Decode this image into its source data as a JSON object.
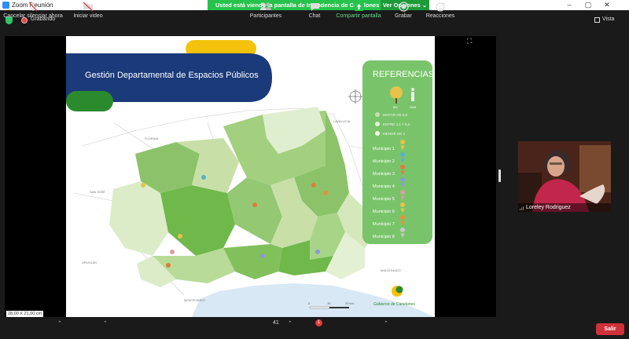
{
  "window": {
    "title": "Zoom Reunión"
  },
  "banner": {
    "message": "Usted está viendo la pantalla de Intendencia de Canelones",
    "options_label": "Ver Opciones"
  },
  "status": {
    "recording_label": "Grabando",
    "view_label": "Vista"
  },
  "slide": {
    "heading": "Gestión Departamental de Espacios Públicos",
    "legend_title": "REFERENCIAS",
    "legend_small": [
      "M2",
      "HAB"
    ],
    "legend_ranges": [
      "MAYOR DE 8.5",
      "ENTRE 4,5 Y 8,5",
      "MENOR DE 4"
    ],
    "legend_regions": [
      "Municipio 1",
      "Municipio 2",
      "Municipio 3",
      "Municipio 4",
      "Municipio 5",
      "Municipio 6",
      "Municipio 7",
      "Municipio 8"
    ],
    "region_colors": [
      "#e8c24a",
      "#5ab0c8",
      "#e07a3c",
      "#8a9ad8",
      "#d9a0a0",
      "#e8c24a",
      "#e8903c",
      "#c8c8c8"
    ],
    "map_labels": [
      "FLORIDA",
      "LAVALLEJA",
      "SAN JOSÉ",
      "MONTEVIDEO",
      "MALDONADO",
      "URUGUAY"
    ],
    "scale_ticks": [
      "0",
      "10",
      "20 km"
    ],
    "logo_text": "Gobierno de Canelones",
    "scale_text": "28,00 X 21,00 cm"
  },
  "participant": {
    "name": "Loreley Rodriguez"
  },
  "toolbar": {
    "mute_label": "Cancelar silenciar ahora",
    "video_label": "Iniciar video",
    "participants_label": "Participantes",
    "participants_count": "41",
    "chat_label": "Chat",
    "chat_badge": "1",
    "share_label": "Compartir pantalla",
    "record_label": "Grabar",
    "reactions_label": "Reacciones",
    "leave_label": "Salir"
  },
  "colors": {
    "accent_green": "#27c24c",
    "leave_red": "#d0303a",
    "navy": "#1b3a7a",
    "map_green": "#8cc36a"
  }
}
